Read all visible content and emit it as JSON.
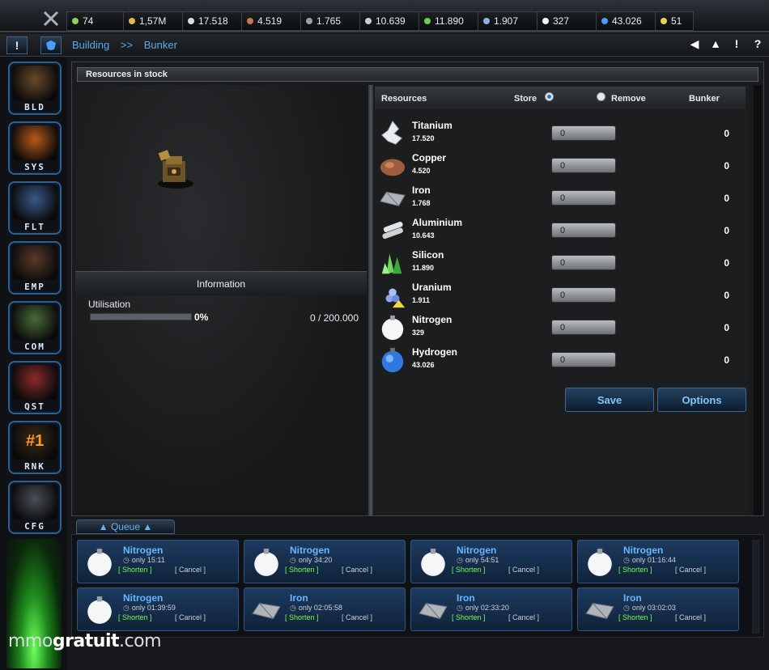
{
  "topbar": {
    "resources": [
      {
        "value": "74",
        "color": "#8fd35a"
      },
      {
        "value": "1,57M",
        "color": "#e3b84f"
      },
      {
        "value": "17.518",
        "color": "#d8dde2"
      },
      {
        "value": "4.519",
        "color": "#c07a5a"
      },
      {
        "value": "1.765",
        "color": "#9aa1a8"
      },
      {
        "value": "10.639",
        "color": "#c9ced3"
      },
      {
        "value": "11.890",
        "color": "#6ecf4a"
      },
      {
        "value": "1.907",
        "color": "#8fb0e8"
      },
      {
        "value": "327",
        "color": "#f2f4f6"
      },
      {
        "value": "43.026",
        "color": "#4a9cff"
      },
      {
        "value": "51",
        "color": "#e3d35a"
      }
    ]
  },
  "subbar": {
    "btn1": "!",
    "crumb": [
      "Building",
      ">>",
      "Bunker"
    ],
    "nav": [
      "◀",
      "▲",
      "!",
      "?"
    ]
  },
  "sidebar": {
    "items": [
      {
        "label": "BLD",
        "bg": "#6a4a2a"
      },
      {
        "label": "SYS",
        "bg": "#b85a1a"
      },
      {
        "label": "FLT",
        "bg": "#3a5a8a"
      },
      {
        "label": "EMP",
        "bg": "#5a3a2a"
      },
      {
        "label": "COM",
        "bg": "#4a6a3a"
      },
      {
        "label": "QST",
        "bg": "#8a2a2a"
      },
      {
        "label": "RNK",
        "bg": "#3a2a1a",
        "badge": "#1"
      },
      {
        "label": "CFG",
        "bg": "#4a5058"
      }
    ]
  },
  "main": {
    "title": "Resources in stock",
    "info_title": "Information",
    "utilisation_label": "Utilisation",
    "utilisation_pct": "0%",
    "utilisation_fill_pct": 0,
    "utilisation_capacity": "0 / 200.000",
    "table": {
      "col_resources": "Resources",
      "col_store": "Store",
      "col_remove": "Remove",
      "col_bunker": "Bunker"
    },
    "rows": [
      {
        "name": "Titanium",
        "amount": "17.520",
        "input": "0",
        "bunker": "0",
        "icon": "titanium-icon"
      },
      {
        "name": "Copper",
        "amount": "4.520",
        "input": "0",
        "bunker": "0",
        "icon": "copper-icon"
      },
      {
        "name": "Iron",
        "amount": "1.768",
        "input": "0",
        "bunker": "0",
        "icon": "iron-icon"
      },
      {
        "name": "Aluminium",
        "amount": "10.643",
        "input": "0",
        "bunker": "0",
        "icon": "aluminium-icon"
      },
      {
        "name": "Silicon",
        "amount": "11.890",
        "input": "0",
        "bunker": "0",
        "icon": "silicon-icon"
      },
      {
        "name": "Uranium",
        "amount": "1.911",
        "input": "0",
        "bunker": "0",
        "icon": "uranium-icon"
      },
      {
        "name": "Nitrogen",
        "amount": "329",
        "input": "0",
        "bunker": "0",
        "icon": "nitrogen-icon"
      },
      {
        "name": "Hydrogen",
        "amount": "43.026",
        "input": "0",
        "bunker": "0",
        "icon": "hydrogen-icon"
      }
    ],
    "save_label": "Save",
    "options_label": "Options"
  },
  "queue": {
    "tab_label": "▲ Queue ▲",
    "shorten": "[ Shorten ]",
    "cancel": "[ Cancel ]",
    "items": [
      {
        "name": "Nitrogen",
        "time": "only 15:11",
        "kind": "nitrogen"
      },
      {
        "name": "Nitrogen",
        "time": "only 34:20",
        "kind": "nitrogen"
      },
      {
        "name": "Nitrogen",
        "time": "only 54:51",
        "kind": "nitrogen"
      },
      {
        "name": "Nitrogen",
        "time": "only 01:16:44",
        "kind": "nitrogen"
      },
      {
        "name": "Nitrogen",
        "time": "only 01:39:59",
        "kind": "nitrogen"
      },
      {
        "name": "Iron",
        "time": "only 02:05:58",
        "kind": "iron"
      },
      {
        "name": "Iron",
        "time": "only 02:33:20",
        "kind": "iron"
      },
      {
        "name": "Iron",
        "time": "only 03:02:03",
        "kind": "iron"
      }
    ]
  },
  "watermark": {
    "a": "mmo",
    "b": "gratuit",
    "c": ".com"
  }
}
